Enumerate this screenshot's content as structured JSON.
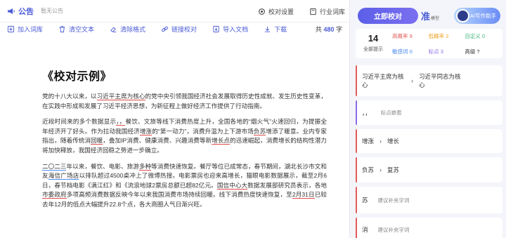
{
  "notice": {
    "label": "公告",
    "text": "暂无公告"
  },
  "top_actions": [
    {
      "label": "校对设置",
      "icon": "gear-icon"
    },
    {
      "label": "行业词库",
      "icon": "book-icon"
    }
  ],
  "toolbar": {
    "items": [
      {
        "label": "加入词库",
        "icon": "add-dict-icon"
      },
      {
        "label": "清空文本",
        "icon": "clear-text-icon"
      },
      {
        "label": "清除格式",
        "icon": "clear-format-icon"
      },
      {
        "label": "链接校对",
        "icon": "link-icon"
      },
      {
        "label": "导入文档",
        "icon": "import-icon"
      },
      {
        "label": "下载",
        "icon": "download-icon"
      }
    ],
    "count_prefix": "共",
    "count": "480",
    "count_suffix": "字"
  },
  "doc": {
    "title": "《校对示例》",
    "p1": [
      "党的十八大以来，以",
      "习近平主席为核心",
      "的党中央引领我国经济社会发展取得历史性成就、发生历史性变革，在实践中形成和发展了习近平经济思想，为新征程上做好经济工作提供了行动指南。"
    ],
    "p2": [
      "近段时间来的多个数据显示",
      "，，",
      "餐饮、文旅等线下消费热度上升，全国各地的“烟火气”火速回归，为提振全年经济开了好头。作为拉动我国经济",
      "增涨",
      "的“第一动力”，消费升温为上下游市场",
      "负苏",
      "增添了暖意。业内专家指出，随着传统消",
      "回暖",
      "，叠加IP消费、健康消费、兴趣消费等新",
      "增长点",
      "的迅速崛起，消费增长的结构性潜力将加快释放，我国经济回稳之势进一步确立。"
    ],
    "p3": [
      "二〇二三",
      "年以来，餐饮、电影、旅游",
      "多种",
      "等消费快速恢复。餐厅等位已成常态，春节期间，湖北长沙市文和友",
      "海信广场店",
      "以排队超过4500桌冲上了微博热搜。电影票房也迎来高增长，猫眼电影数据展示，截至2月6日，春节档电影《满江红》和《流浪地球2票房总额已超82亿元。",
      "国信中心大",
      "数据发展部研究员表示，各地",
      "市委政府",
      "多项高频消费数据反映今年以来我国消费市场持续回暖。线下消费热度快速恢复，至",
      "2月31日",
      "已较去年12月的低点大幅提升22.8个点，各大商圈人气日渐兴旺。"
    ]
  },
  "side": {
    "check_button": "立即校对",
    "zhun": "准",
    "zhun_sub": "模型",
    "ai_button": "AI写作助手",
    "total_count": "14",
    "total_label": "全部提示",
    "stats": [
      {
        "label": "高概率",
        "value": "9",
        "color": "#e25a5a"
      },
      {
        "label": "低概率",
        "value": "2",
        "color": "#f0a020"
      },
      {
        "label": "自定义",
        "value": "0",
        "color": "#3fb87e"
      },
      {
        "label": "敏感词",
        "value": "0",
        "color": "#4a8cf0"
      },
      {
        "label": "标点",
        "value": "3",
        "color": "#8a6be8"
      },
      {
        "label": "高级",
        "value": "?",
        "color": "#333333"
      }
    ],
    "suggestions": [
      {
        "orig": "习近平主席为核心",
        "new": "习近平同志为核心",
        "hint": ""
      },
      {
        "orig": "，，",
        "new": "",
        "hint": "标点嵌套"
      },
      {
        "orig": "增涨",
        "new": "增长",
        "hint": ""
      },
      {
        "orig": "负苏",
        "new": "复苏",
        "hint": ""
      },
      {
        "orig": "苏",
        "new": "",
        "hint": "建议补充字词"
      },
      {
        "orig": "消",
        "new": "",
        "hint": "建议补充字词"
      }
    ]
  }
}
